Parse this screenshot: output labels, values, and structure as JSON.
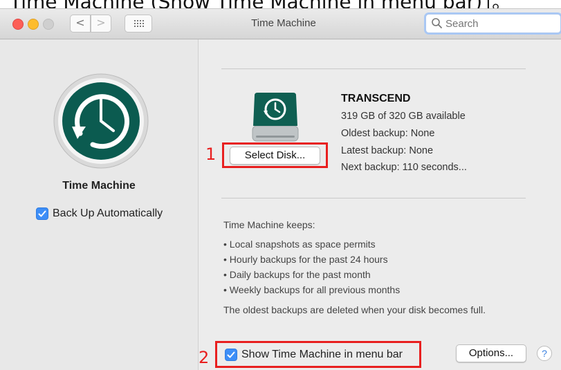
{
  "caption": "Time Machine (Show Time Machine in menu bar)」。",
  "titlebar": {
    "title": "Time Machine",
    "back_glyph": "<",
    "forward_glyph": ">",
    "search_placeholder": "Search"
  },
  "sidebar": {
    "title": "Time Machine",
    "backup_automatically": {
      "label": "Back Up Automatically",
      "checked": true
    }
  },
  "disk": {
    "name": "TRANSCEND",
    "available": "319 GB of 320 GB available",
    "oldest_backup": "Oldest backup: None",
    "latest_backup": "Latest backup: None",
    "next_backup": "Next backup: 110 seconds..."
  },
  "buttons": {
    "select_disk": "Select Disk...",
    "options": "Options...",
    "help": "?"
  },
  "keeps": {
    "intro": "Time Machine keeps:",
    "items": [
      "• Local snapshots as space permits",
      "• Hourly backups for the past 24 hours",
      "• Daily backups for the past month",
      "• Weekly backups for all previous months"
    ],
    "note": "The oldest backups are deleted when your disk becomes full."
  },
  "menu_bar_option": {
    "label": "Show Time Machine in menu bar",
    "checked": true
  },
  "annotations": {
    "one": "1",
    "two": "2"
  },
  "colors": {
    "accent": "#3d8ef7",
    "highlight": "#e81f1f",
    "icon_teal": "#0b5b50"
  }
}
